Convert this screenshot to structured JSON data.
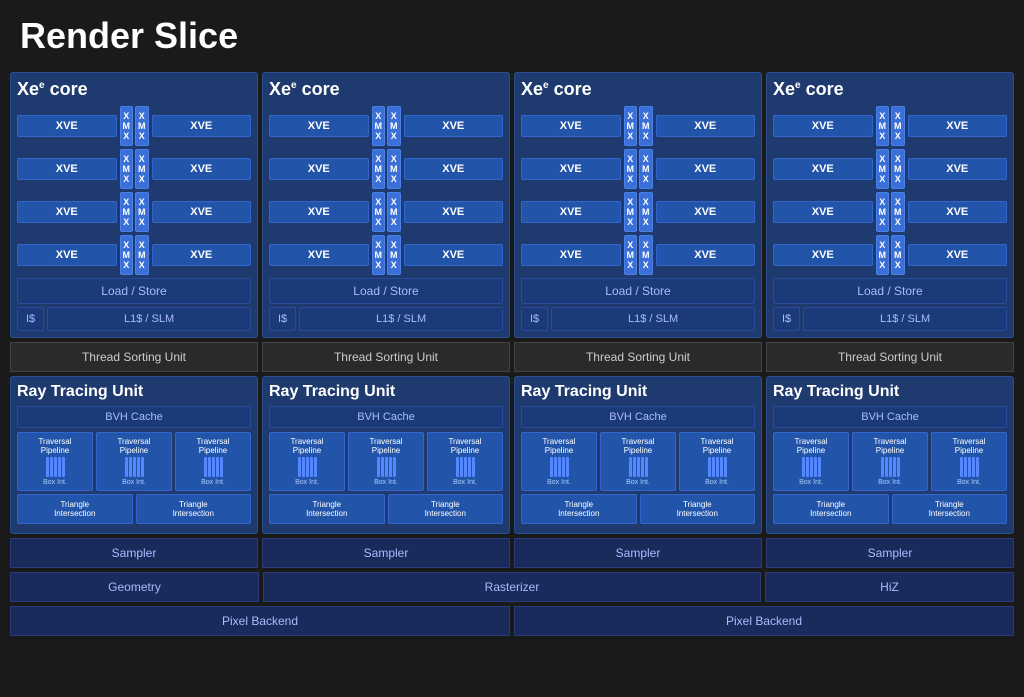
{
  "title": "Render Slice",
  "xe_cores": [
    {
      "id": 1,
      "title": "Xe",
      "sub": "e",
      "suffix": "core"
    },
    {
      "id": 2,
      "title": "Xe",
      "sub": "e",
      "suffix": "core"
    },
    {
      "id": 3,
      "title": "Xe",
      "sub": "e",
      "suffix": "core"
    },
    {
      "id": 4,
      "title": "Xe",
      "sub": "e",
      "suffix": "core"
    }
  ],
  "xve_label": "XVE",
  "xmx_label_top": "X M",
  "xmx_label_bot": "X",
  "load_store_label": "Load / Store",
  "is_label": "I$",
  "l1_slm_label": "L1$ / SLM",
  "thread_sorting_label": "Thread Sorting Unit",
  "ray_tracing_label": "Ray Tracing Unit",
  "bvh_cache_label": "BVH Cache",
  "traversal_pipeline_label": "Traversal Pipeline",
  "box_int_label": "Box Int.",
  "triangle_intersection_label": "Triangle Intersection",
  "sampler_label": "Sampler",
  "geometry_label": "Geometry",
  "rasterizer_label": "Rasterizer",
  "hiz_label": "HiZ",
  "pixel_backend_label": "Pixel Backend"
}
